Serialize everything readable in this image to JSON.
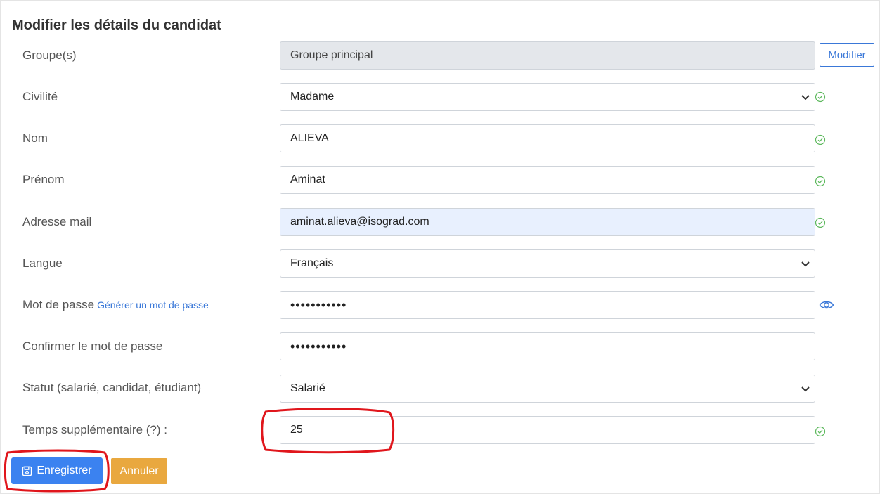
{
  "form": {
    "title": "Modifier les détails du candidat",
    "modify_button": "Modifier",
    "generate_password_link": "Générer un mot de passe",
    "fields": {
      "groups": {
        "label": "Groupe(s)",
        "value": "Groupe principal"
      },
      "civility": {
        "label": "Civilité",
        "value": "Madame"
      },
      "last_name": {
        "label": "Nom",
        "value": "ALIEVA"
      },
      "first_name": {
        "label": "Prénom",
        "value": "Aminat"
      },
      "email": {
        "label": "Adresse mail",
        "value": "aminat.alieva@isograd.com"
      },
      "language": {
        "label": "Langue",
        "value": "Français"
      },
      "password": {
        "label": "Mot de passe",
        "value": "•••••••••••"
      },
      "confirm_password": {
        "label": "Confirmer le mot de passe",
        "value": "•••••••••••"
      },
      "status": {
        "label": "Statut (salarié, candidat, étudiant)",
        "value": "Salarié"
      },
      "extra_time": {
        "label": "Temps supplémentaire (?) :",
        "value": "25"
      }
    },
    "save_button": "Enregistrer",
    "cancel_button": "Annuler"
  },
  "colors": {
    "primary": "#3b82f0",
    "link": "#3a78d8",
    "warning": "#e9a83f",
    "success": "#5cb85c",
    "annotation": "#e0161c"
  },
  "icons": [
    "chevron-down-icon",
    "check-circle-icon",
    "eye-icon",
    "save-icon"
  ]
}
